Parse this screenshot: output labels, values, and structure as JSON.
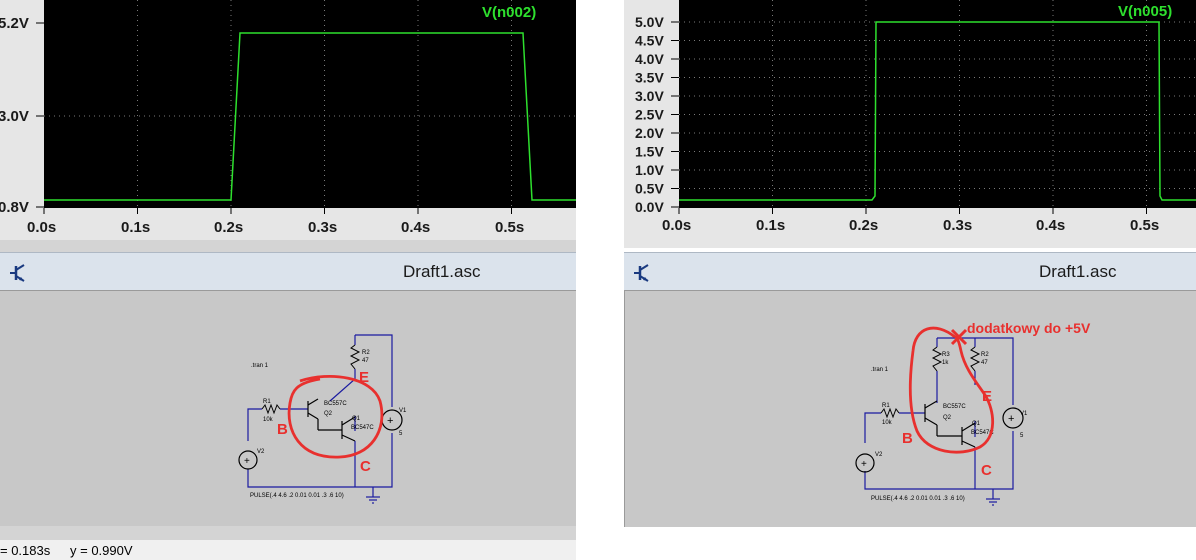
{
  "left": {
    "plot": {
      "trace_label": "V(n002)",
      "y_ticks": [
        "5.2V",
        "3.0V",
        "0.8V"
      ],
      "x_ticks": [
        "0.0s",
        "0.1s",
        "0.2s",
        "0.3s",
        "0.4s",
        "0.5s"
      ],
      "trace_color": "#2ee02e"
    },
    "schematic": {
      "title": "Draft1.asc",
      "directive": ".tran 1",
      "source_spec": "PULSE(.4 4.6 .2 0.01 0.01 .3 .6 10)",
      "parts": {
        "r1": "R1",
        "r1_val": "10k",
        "r2": "R2",
        "r2_val": "47",
        "q2": "Q2",
        "q2_type": "BC557C",
        "q1": "Q1",
        "q1_type": "BC547C",
        "v1": "V1",
        "v1_val": "5",
        "v2": "V2"
      },
      "annotations": {
        "e": "E",
        "b": "B",
        "c": "C"
      }
    },
    "status": {
      "x_readout": "= 0.183s",
      "y_readout": "y = 0.990V"
    }
  },
  "right": {
    "plot": {
      "trace_label": "V(n005)",
      "y_ticks": [
        "5.0V",
        "4.5V",
        "4.0V",
        "3.5V",
        "3.0V",
        "2.5V",
        "2.0V",
        "1.5V",
        "1.0V",
        "0.5V",
        "0.0V"
      ],
      "x_ticks": [
        "0.0s",
        "0.1s",
        "0.2s",
        "0.3s",
        "0.4s",
        "0.5s"
      ],
      "trace_color": "#2ee02e"
    },
    "schematic": {
      "title": "Draft1.asc",
      "directive": ".tran 1",
      "source_spec": "PULSE(.4 4.6 .2 0.01 0.01 .3 .6 10)",
      "parts": {
        "r1": "R1",
        "r1_val": "10k",
        "r2": "R2",
        "r2_val": "47",
        "r3": "R3",
        "r3_val": "1k",
        "q2": "Q2",
        "q2_type": "BC557C",
        "q1": "Q1",
        "q1_type": "BC547C",
        "v1": "V1",
        "v1_val": "5",
        "v2": "V2"
      },
      "annotations": {
        "e": "E",
        "b": "B",
        "c": "C",
        "note": "dodatkowy do +5V"
      }
    }
  },
  "colors": {
    "plot_bg": "#000000",
    "grid": "#7a7a7a",
    "annotation": "#e8302e",
    "wire": "#1a1aa0",
    "title_bar": "#dbe3ec"
  }
}
